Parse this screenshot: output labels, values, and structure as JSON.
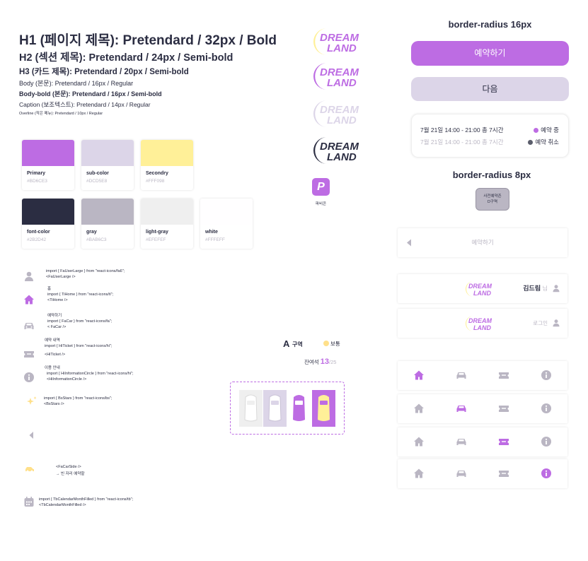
{
  "typography": {
    "h1": "H1 (페이지 제목): Pretendard / 32px / Bold",
    "h2": "H2 (섹션 제목): Pretendard / 24px / Semi-bold",
    "h3": "H3 (카드 제목): Pretendard / 20px / Semi-bold",
    "body": "Body (본문): Pretendard / 16px / Regular",
    "body_bold": "Body-bold (본문): Pretendard / 16px / Semi-bold",
    "caption": "Caption (보조텍스트): Pretendard / 14px / Regular",
    "overline": "Overline (작은 메뉴): Pretendard / 10px / Regular"
  },
  "colors": [
    {
      "name": "Primary",
      "hex": "#BD6CE3",
      "color": "#BD6CE3"
    },
    {
      "name": "sub-color",
      "hex": "#DCD5E8",
      "color": "#DCD5E8"
    },
    {
      "name": "Secondry",
      "hex": "#FFF098",
      "color": "#FFF098"
    },
    {
      "name": "font-color",
      "hex": "#2B2D42",
      "color": "#2B2D42"
    },
    {
      "name": "gray",
      "hex": "#BAB6C3",
      "color": "#BAB6C3"
    },
    {
      "name": "light-gray",
      "hex": "#EFEFEF",
      "color": "#EFEFEF"
    },
    {
      "name": "white",
      "hex": "#FFFEFF",
      "color": "#FFFEFF"
    }
  ],
  "icons": [
    {
      "icon": "user-icon",
      "lines": [
        "import { FaUserLarge } from \"react-icons/fa6\";",
        "<FaUserLarge />"
      ]
    },
    {
      "icon": "home-icon",
      "lines": [
        "홈",
        "import { TiHome } from \"react-icons/ti\";",
        "<TiHome />"
      ]
    },
    {
      "icon": "car-icon",
      "lines": [
        "예약하기",
        "import { FaCar } from \"react-icons/fa\";",
        "< FaCar  />"
      ]
    },
    {
      "icon": "ticket-icon",
      "lines": [
        "예약 내역",
        "import { HiTicket } from \"react-icons/hi\";",
        "",
        "<HiTicket />"
      ]
    },
    {
      "icon": "info-icon",
      "lines": [
        "이용 안내",
        "import { HiInformationCircle } from \"react-icons/hi\";",
        "<HiInformationCircle />"
      ]
    },
    {
      "icon": "stars-icon",
      "lines": [
        "import { BsStars } from \"react-icons/bs\";",
        "<BsStars />"
      ]
    },
    {
      "icon": "chevron-left-icon",
      "lines": []
    },
    {
      "icon": "car-side-icon",
      "lines": [
        "<FaCarSide />",
        "→ 빈 자리 예약할"
      ]
    },
    {
      "icon": "calendar-icon",
      "lines": [
        "import { TbCalendarMonthFilled } from \"react-icons/tb\";",
        "<TbCalendarMonthFilled />"
      ]
    }
  ],
  "brand": {
    "logo_line1": "DREAM",
    "logo_line2": "LAND",
    "app_icon_letter": "P",
    "app_icon_label": "파비콘"
  },
  "parking": {
    "zone_letter": "A",
    "zone_label": "구역",
    "status": "보통",
    "remaining_label": "잔여석",
    "remaining": "13",
    "total": "/25",
    "slots": [
      "empty",
      "selected-white",
      "occupied",
      "available-yellow"
    ]
  },
  "components": {
    "radius16_title": "border-radius 16px",
    "primary_button": "예약하기",
    "sub_button": "다음",
    "reservations": [
      {
        "text": "7월 21일 14:00 - 21:00 총 7시간",
        "status": "예약 중",
        "dot": "#BD6CE3"
      },
      {
        "text": "7월 21일 14:00 - 21:00 총 7시간",
        "status": "예약 취소",
        "dot": "#5a5d6b"
      }
    ],
    "radius8_title": "border-radius 8px",
    "chip_line1": "사전예약존",
    "chip_line2": "D구역",
    "back_bar_label": "예약하기",
    "user_name": "김드림",
    "user_suffix": "님",
    "login_label": "로그인"
  }
}
